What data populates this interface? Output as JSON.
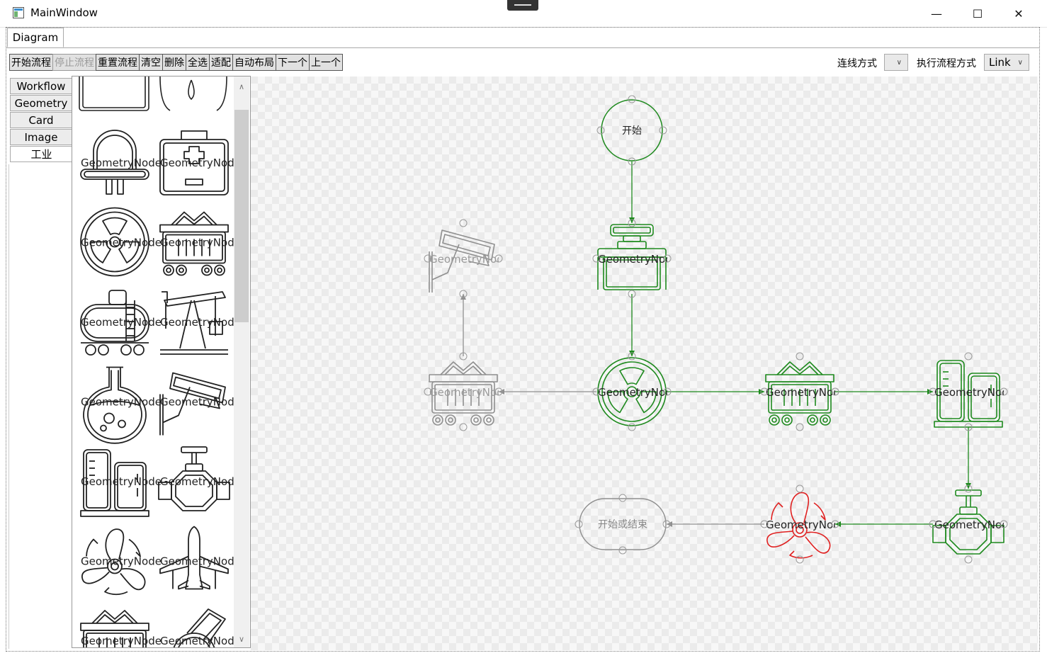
{
  "window": {
    "title": "MainWindow",
    "minimize": "—",
    "maximize": "☐",
    "close": "✕"
  },
  "tabs": [
    {
      "label": "Diagram"
    }
  ],
  "toolbar": {
    "buttons": [
      {
        "label": "开始流程",
        "enabled": true
      },
      {
        "label": "停止流程",
        "enabled": false
      },
      {
        "label": "重置流程",
        "enabled": true
      },
      {
        "label": "清空",
        "enabled": true
      },
      {
        "label": "删除",
        "enabled": true
      },
      {
        "label": "全选",
        "enabled": true
      },
      {
        "label": "适配",
        "enabled": true
      },
      {
        "label": "自动布局",
        "enabled": true
      },
      {
        "label": "下一个",
        "enabled": true
      },
      {
        "label": "上一个",
        "enabled": true
      }
    ],
    "link_mode_label": "连线方式",
    "link_mode_value": "",
    "exec_mode_label": "执行流程方式",
    "exec_mode_value": "Link"
  },
  "sidebar": {
    "tabs": [
      {
        "label": "Workflow",
        "active": false
      },
      {
        "label": "Geometry",
        "active": false
      },
      {
        "label": "Card",
        "active": false
      },
      {
        "label": "Image",
        "active": false
      },
      {
        "label": "工业",
        "active": true
      }
    ]
  },
  "toolbox": {
    "item_label": "GeometryNode",
    "items": [
      {
        "icon": "socket-plug-icon"
      },
      {
        "icon": "first-aid-kit-icon"
      },
      {
        "icon": "radiation-icon"
      },
      {
        "icon": "mine-cart-icon"
      },
      {
        "icon": "tank-car-icon"
      },
      {
        "icon": "oil-pump-icon"
      },
      {
        "icon": "flask-icon"
      },
      {
        "icon": "surveillance-camera-icon"
      },
      {
        "icon": "storage-tanks-icon"
      },
      {
        "icon": "pipe-valve-icon"
      },
      {
        "icon": "fan-icon"
      },
      {
        "icon": "airplane-icon"
      },
      {
        "icon": "hopper-cart-icon"
      },
      {
        "icon": "rotary-device-icon"
      }
    ]
  },
  "diagram": {
    "colors": {
      "active": "#1e8a1e",
      "inactive": "#8f8f8f",
      "error": "#e02020"
    },
    "nodes": [
      {
        "id": "start",
        "label": "开始",
        "kind": "circle",
        "state": "active"
      },
      {
        "id": "press",
        "label": "GeometryNode",
        "icon": "press-icon",
        "state": "active"
      },
      {
        "id": "camera",
        "label": "GeometryNode",
        "icon": "surveillance-camera-icon",
        "state": "inactive"
      },
      {
        "id": "radiation",
        "label": "GeometryNode",
        "icon": "radiation-icon",
        "state": "active"
      },
      {
        "id": "cart-left",
        "label": "GeometryNode",
        "icon": "mine-cart-icon",
        "state": "inactive"
      },
      {
        "id": "cart-right",
        "label": "GeometryNode",
        "icon": "mine-cart-icon",
        "state": "active"
      },
      {
        "id": "tanks",
        "label": "GeometryNode",
        "icon": "storage-tanks-icon",
        "state": "active"
      },
      {
        "id": "valve",
        "label": "GeometryNode",
        "icon": "pipe-valve-icon",
        "state": "active"
      },
      {
        "id": "fan",
        "label": "GeometryNode",
        "icon": "fan-icon",
        "state": "error"
      },
      {
        "id": "end",
        "label": "开始或结束",
        "kind": "terminal",
        "state": "inactive"
      }
    ],
    "links": [
      {
        "from": "start",
        "to": "press",
        "state": "active"
      },
      {
        "from": "press",
        "to": "radiation",
        "state": "active"
      },
      {
        "from": "radiation",
        "to": "cart-left",
        "state": "inactive"
      },
      {
        "from": "cart-left",
        "to": "camera",
        "state": "inactive"
      },
      {
        "from": "radiation",
        "to": "cart-right",
        "state": "active"
      },
      {
        "from": "cart-right",
        "to": "tanks",
        "state": "active"
      },
      {
        "from": "tanks",
        "to": "valve",
        "state": "active"
      },
      {
        "from": "valve",
        "to": "fan",
        "state": "active"
      },
      {
        "from": "fan",
        "to": "end",
        "state": "inactive"
      }
    ]
  }
}
